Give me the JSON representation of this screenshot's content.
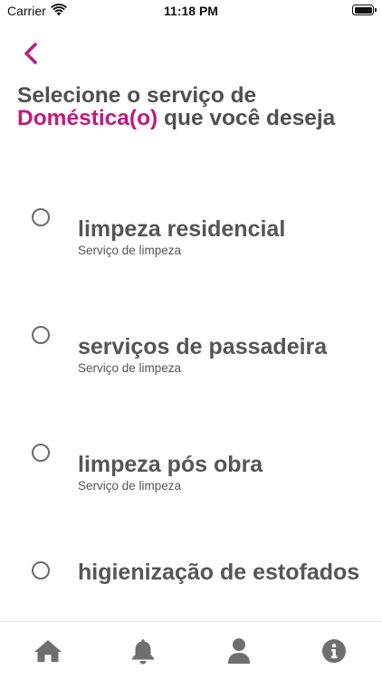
{
  "status_bar": {
    "carrier": "Carrier",
    "time": "11:18 PM",
    "icons": [
      "wifi-icon",
      "battery-icon"
    ]
  },
  "nav": {
    "back_icon": "chevron-left-icon"
  },
  "heading": {
    "line_prefix": "Selecione o serviço de",
    "accent": "Doméstica(o)",
    "line_suffix": " que você deseja",
    "accent_color": "#c2187e"
  },
  "services": [
    {
      "title": "limpeza residencial",
      "subtitle": "Serviço de limpeza",
      "selected": false
    },
    {
      "title": "serviços de passadeira",
      "subtitle": "Serviço de limpeza",
      "selected": false
    },
    {
      "title": "limpeza pós obra",
      "subtitle": "Serviço de limpeza",
      "selected": false
    },
    {
      "title": "higienização de estofados",
      "subtitle": "",
      "selected": false
    }
  ],
  "tab_bar": {
    "tabs": [
      {
        "icon": "home-icon"
      },
      {
        "icon": "bell-icon"
      },
      {
        "icon": "user-icon"
      },
      {
        "icon": "info-icon"
      }
    ],
    "icon_color": "#6f6f6f"
  }
}
